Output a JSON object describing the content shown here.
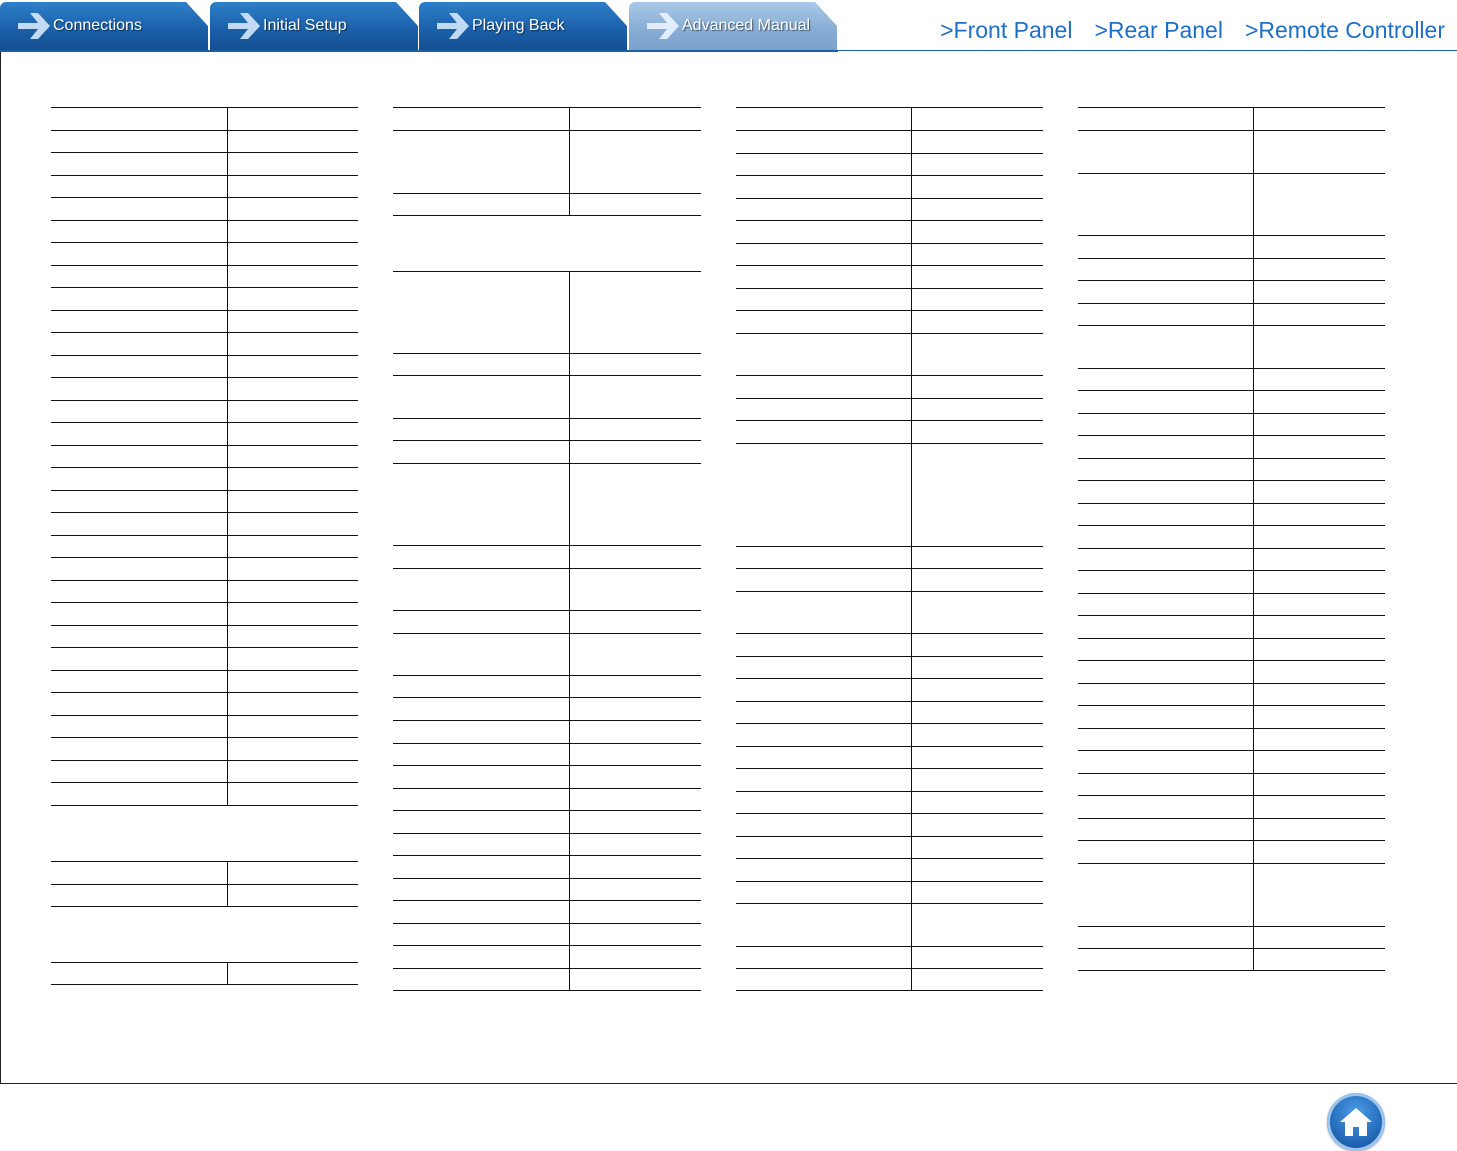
{
  "tabs": [
    {
      "label": "Connections",
      "active": false
    },
    {
      "label": "Initial Setup",
      "active": false
    },
    {
      "label": "Playing Back",
      "active": false
    },
    {
      "label": "Advanced Manual",
      "active": true
    }
  ],
  "links": [
    ">Front Panel",
    ">Rear Panel",
    ">Remote Controller"
  ],
  "colors": {
    "tab_blue": "#1a5fa8",
    "tab_active": "#86acd3",
    "link_blue": "#1f6fc6"
  },
  "icons": {
    "tab_arrow": "arrow-right-icon",
    "home": "home-icon"
  }
}
